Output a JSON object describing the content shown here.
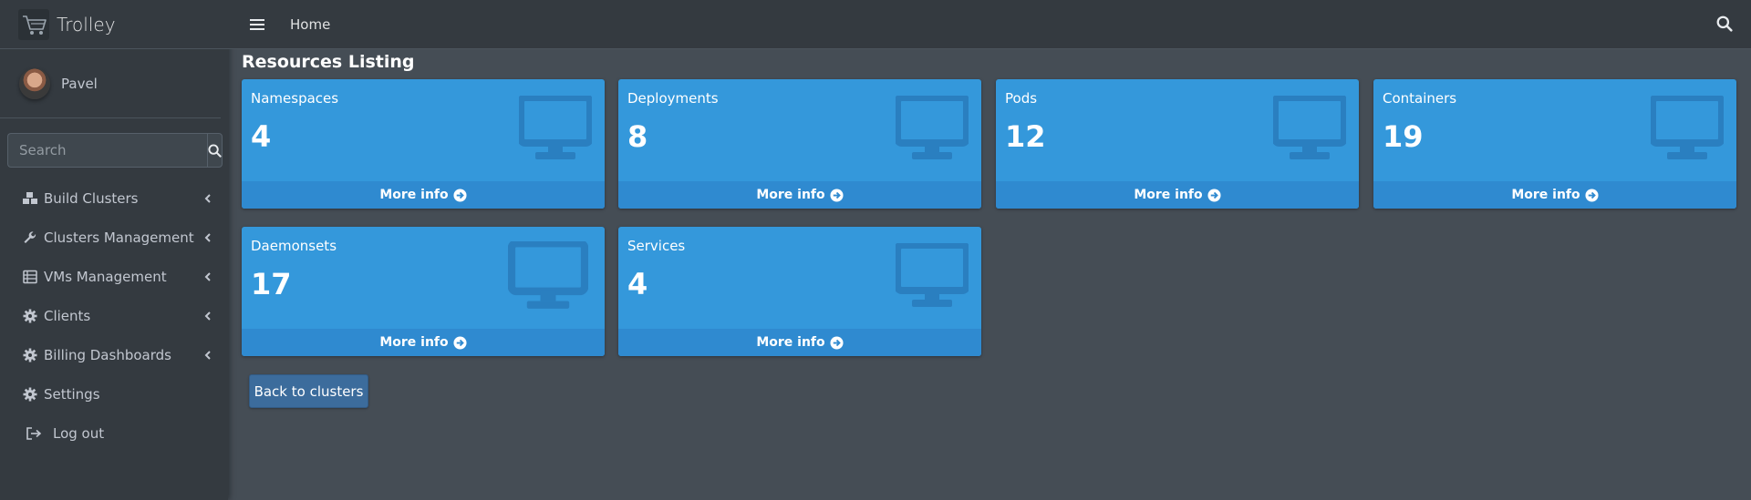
{
  "brand": {
    "name": "Trolley",
    "logo_icon": "cart-icon"
  },
  "user": {
    "name": "Pavel"
  },
  "sidebar": {
    "search_placeholder": "Search",
    "items": [
      {
        "label": "Build Clusters",
        "icon": "cubes-icon",
        "has_submenu": true
      },
      {
        "label": "Clusters Management",
        "icon": "wrench-icon",
        "has_submenu": true
      },
      {
        "label": "VMs Management",
        "icon": "server-icon",
        "has_submenu": true
      },
      {
        "label": "Clients",
        "icon": "gear-icon",
        "has_submenu": true
      },
      {
        "label": "Billing Dashboards",
        "icon": "gear-icon",
        "has_submenu": true
      },
      {
        "label": "Settings",
        "icon": "gear-icon",
        "has_submenu": false
      },
      {
        "label": "Log out",
        "icon": "sign-out-icon",
        "has_submenu": false
      }
    ]
  },
  "topbar": {
    "home_label": "Home"
  },
  "main": {
    "title": "Resources Listing",
    "more_info_label": "More info",
    "boxes": [
      {
        "name": "Namespaces",
        "count": "4"
      },
      {
        "name": "Deployments",
        "count": "8"
      },
      {
        "name": "Pods",
        "count": "12"
      },
      {
        "name": "Containers",
        "count": "19"
      },
      {
        "name": "Daemonsets",
        "count": "17"
      },
      {
        "name": "Services",
        "count": "4"
      }
    ],
    "back_button": "Back to clusters"
  },
  "colors": {
    "sidebar_bg": "#343a40",
    "content_bg": "#454d55",
    "box_bg": "#3498db",
    "box_footer": "#2f8ad0",
    "button_bg": "#3c6c9c"
  }
}
